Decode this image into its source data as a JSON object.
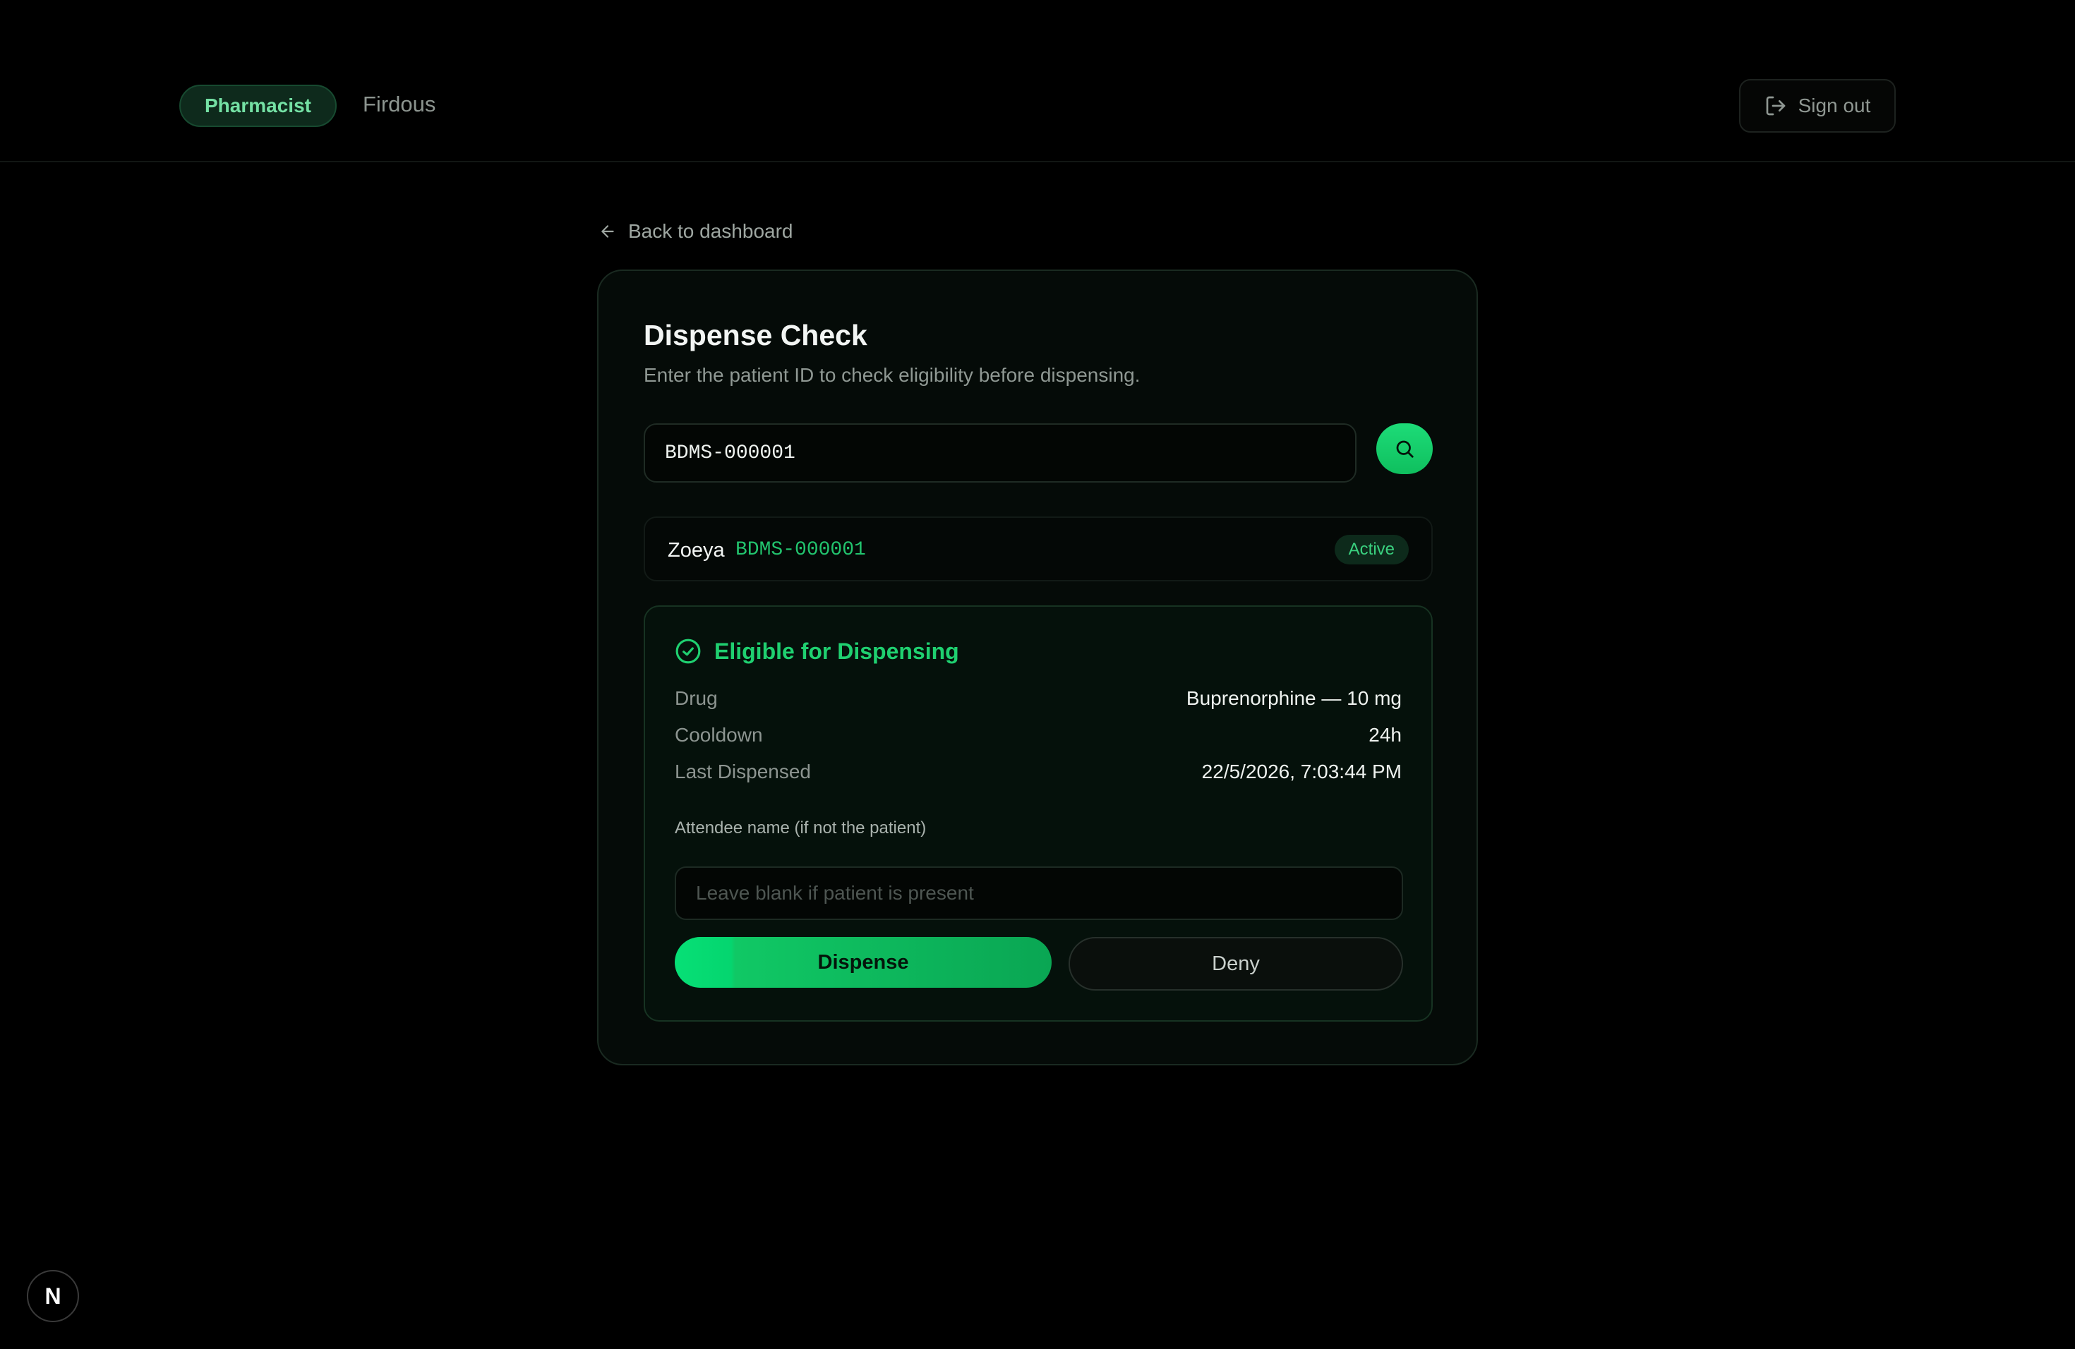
{
  "header": {
    "role": "Pharmacist",
    "user": "Firdous",
    "signout_label": "Sign out"
  },
  "nav": {
    "back_label": "Back to dashboard"
  },
  "card": {
    "title": "Dispense Check",
    "subtitle": "Enter the patient ID to check eligibility before dispensing.",
    "patient_id_value": "BDMS-000001"
  },
  "patient": {
    "name": "Zoeya",
    "id": "BDMS-000001",
    "status": "Active"
  },
  "eligibility": {
    "heading": "Eligible for Dispensing",
    "rows": [
      {
        "label": "Drug",
        "value": "Buprenorphine — 10 mg"
      },
      {
        "label": "Cooldown",
        "value": "24h"
      },
      {
        "label": "Last Dispensed",
        "value": "22/5/2026, 7:03:44 PM"
      }
    ],
    "attendee_label": "Attendee name (if not the patient)",
    "attendee_placeholder": "Leave blank if patient is present",
    "dispense_label": "Dispense",
    "deny_label": "Deny"
  },
  "dev_badge": {
    "label": "N"
  },
  "colors": {
    "accent": "#1fd070",
    "background": "#000000",
    "card": "#050b08"
  }
}
